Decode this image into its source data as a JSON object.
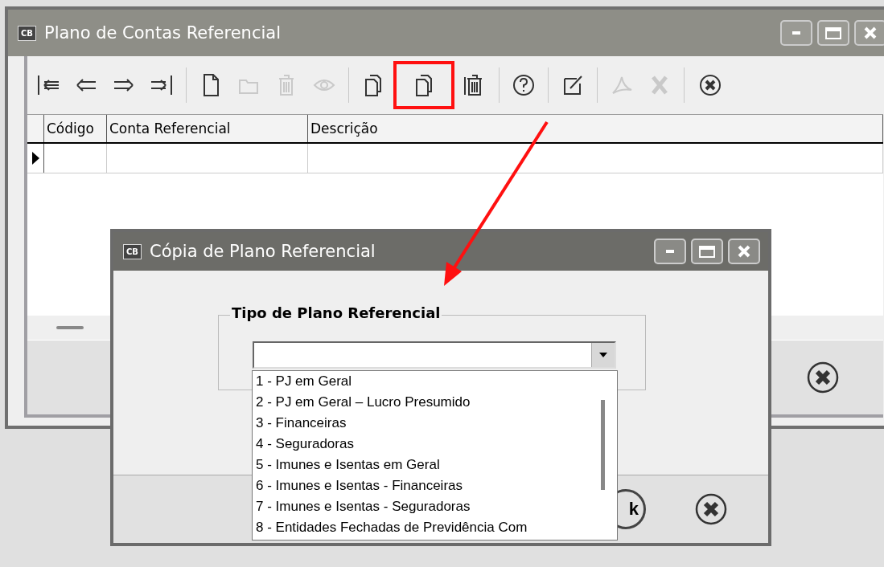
{
  "main_window": {
    "logo": "CB",
    "title": "Plano de Contas Referencial",
    "toolbar": [
      {
        "kind": "first",
        "disabled": false,
        "highlighted": false
      },
      {
        "kind": "prev",
        "disabled": false,
        "highlighted": false
      },
      {
        "kind": "next",
        "disabled": false,
        "highlighted": false
      },
      {
        "kind": "last",
        "disabled": false,
        "highlighted": false
      },
      {
        "kind": "sep"
      },
      {
        "kind": "new",
        "disabled": false,
        "highlighted": false
      },
      {
        "kind": "folder",
        "disabled": true,
        "highlighted": false
      },
      {
        "kind": "trash",
        "disabled": true,
        "highlighted": false
      },
      {
        "kind": "eye",
        "disabled": true,
        "highlighted": false
      },
      {
        "kind": "sep"
      },
      {
        "kind": "copy",
        "disabled": false,
        "highlighted": false
      },
      {
        "kind": "copy",
        "disabled": false,
        "highlighted": true
      },
      {
        "kind": "trash-all",
        "disabled": false,
        "highlighted": false
      },
      {
        "kind": "sep"
      },
      {
        "kind": "help",
        "disabled": false,
        "highlighted": false
      },
      {
        "kind": "sep"
      },
      {
        "kind": "edit",
        "disabled": false,
        "highlighted": false
      },
      {
        "kind": "sep"
      },
      {
        "kind": "pdf",
        "disabled": true,
        "highlighted": false
      },
      {
        "kind": "excel",
        "disabled": true,
        "highlighted": false
      },
      {
        "kind": "sep"
      },
      {
        "kind": "close",
        "disabled": false,
        "highlighted": false
      }
    ],
    "table": {
      "columns": [
        "Código",
        "Conta Referencial",
        "Descrição"
      ]
    }
  },
  "dialog": {
    "logo": "CB",
    "title": "Cópia de Plano Referencial",
    "group_title": "Tipo de Plano Referencial",
    "dropdown": {
      "expanded": true,
      "options": [
        "1 - PJ em Geral",
        "2 - PJ em Geral – Lucro Presumido",
        "3 - Financeiras",
        "4 - Seguradoras",
        "5 - Imunes e Isentas em Geral",
        "6 - Imunes e Isentas - Financeiras",
        "7 - Imunes e Isentas - Seguradoras",
        "8 - Entidades Fechadas de Previdência Com"
      ]
    },
    "ok_label": "k"
  }
}
